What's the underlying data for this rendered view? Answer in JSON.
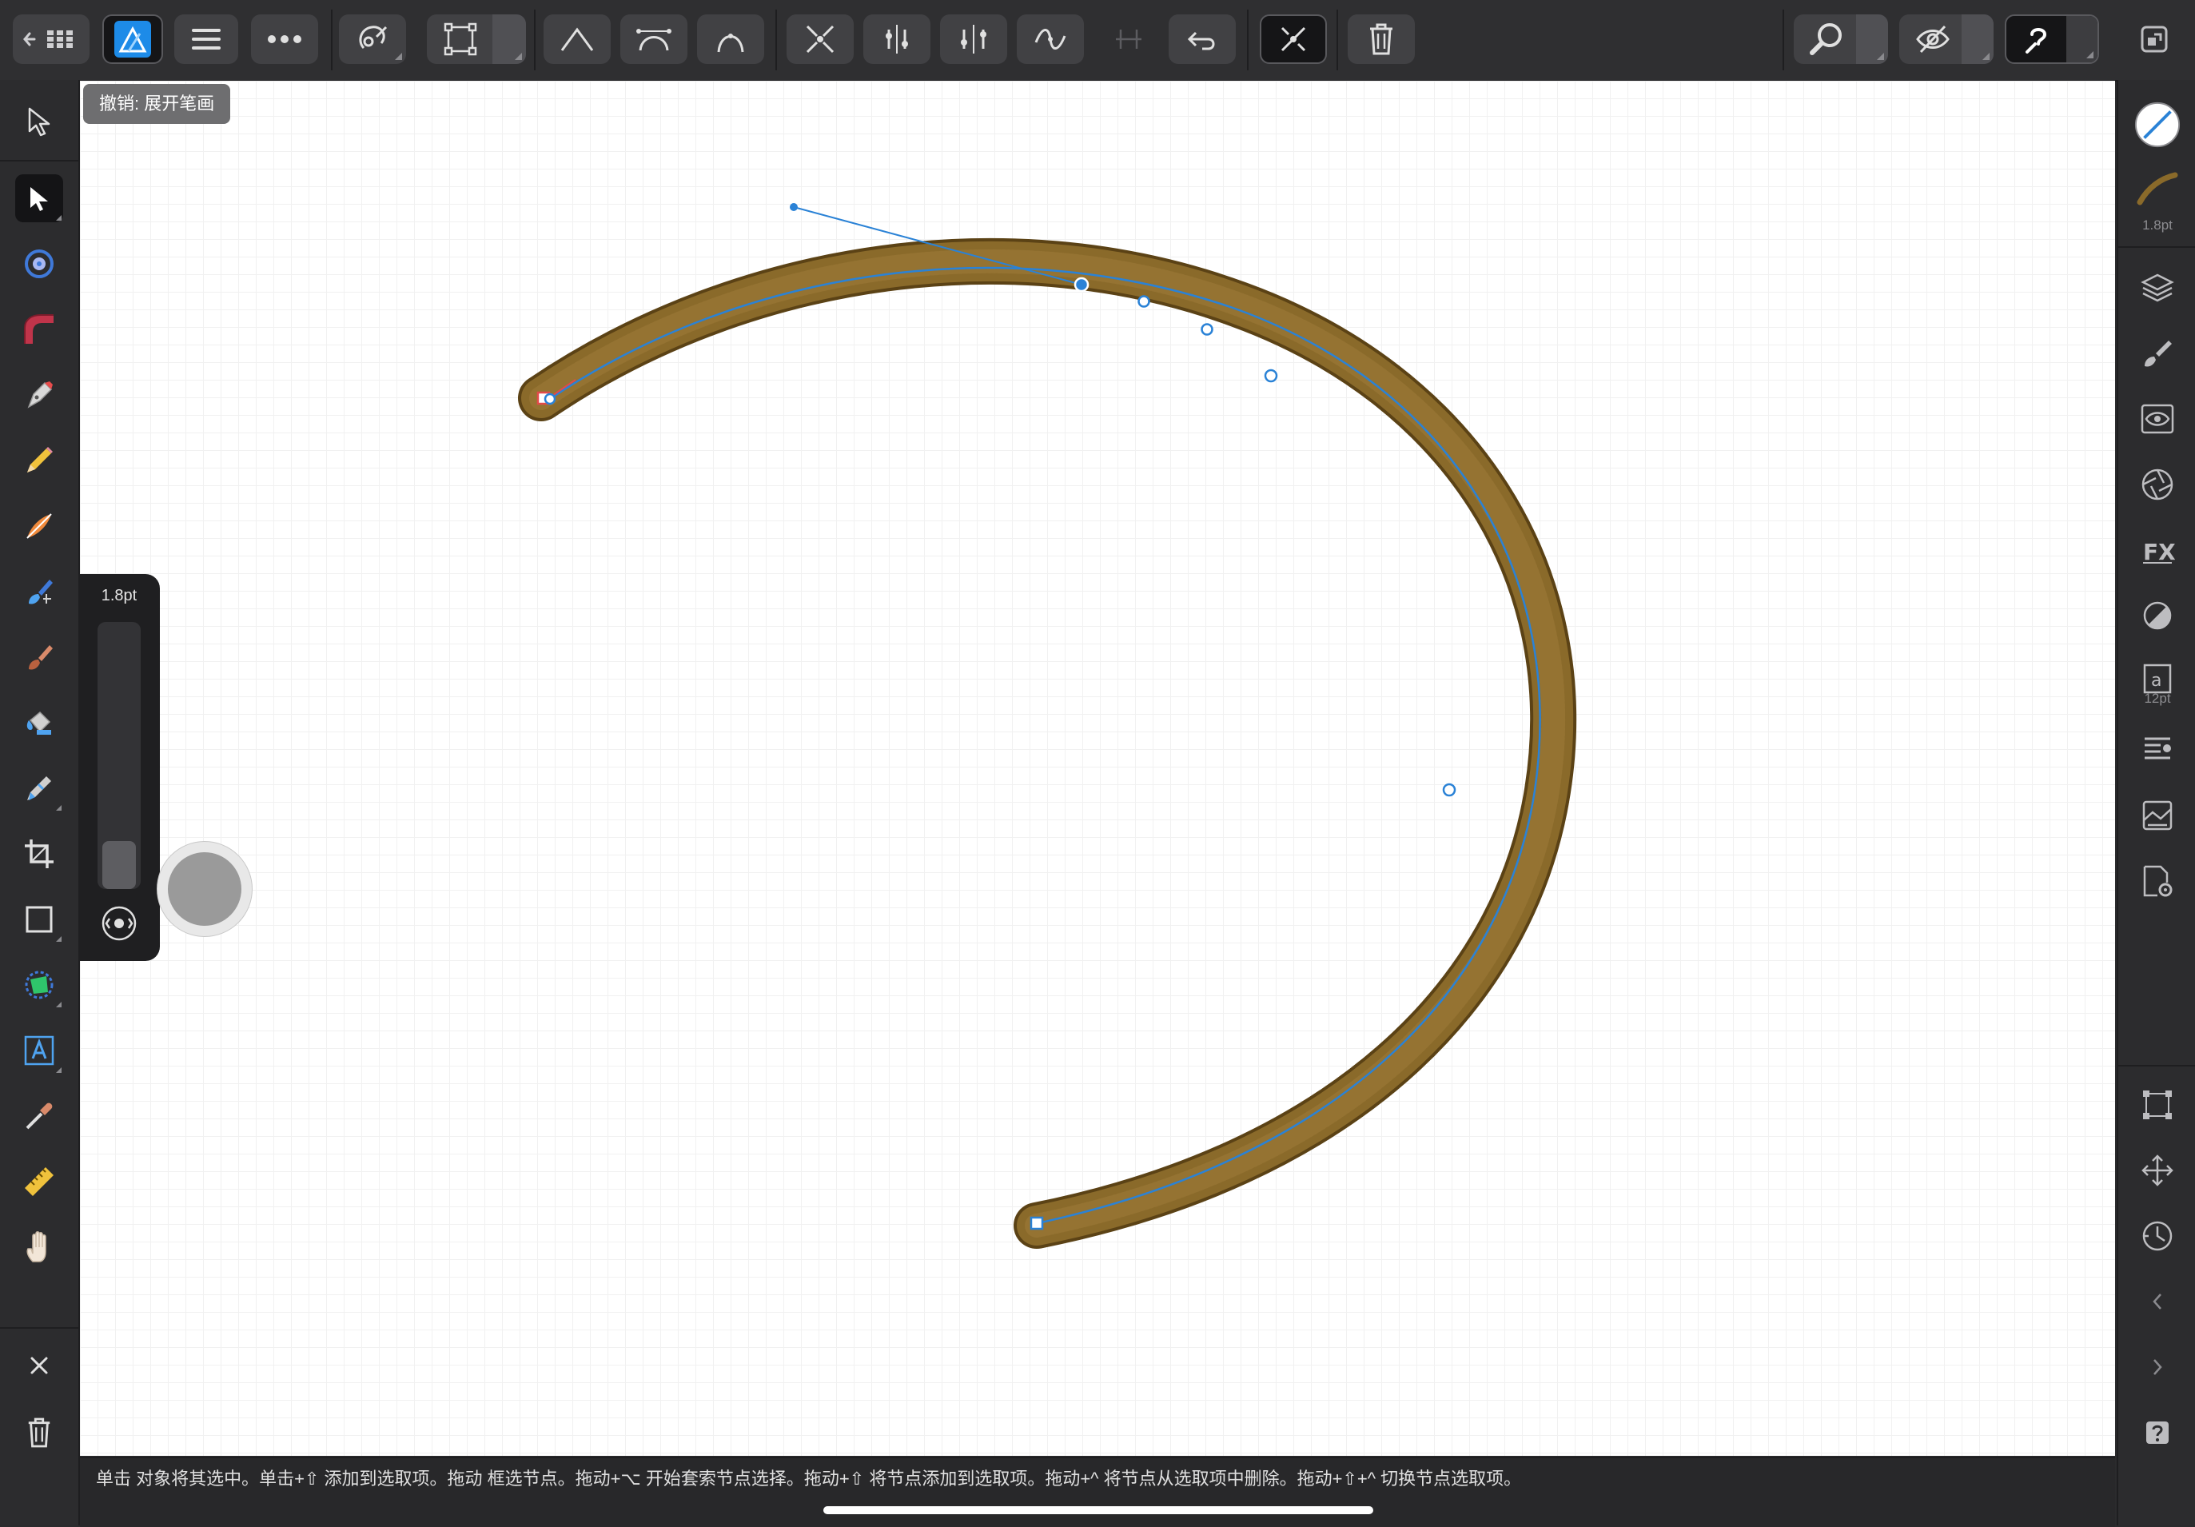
{
  "app": {
    "name": "Affinity Designer",
    "persona": "Designer"
  },
  "colors": {
    "accent": "#2a82d6",
    "stroke_fill": "#8a6a2a",
    "curve_line": "#2a82d6",
    "canvas": "#ffffff",
    "toolbar_bg": "#2f2f31"
  },
  "toolbar": {
    "back_icon": "back-to-documents-icon",
    "items": [
      "affinity-designer-persona-icon",
      "menu-icon",
      "more-icon",
      "snapping-icon",
      "transform-mode-icon",
      "sharp-node-icon",
      "smooth-node-icon",
      "smart-node-icon",
      "break-curve-icon",
      "align-nodes-icon",
      "distribute-nodes-icon",
      "convert-to-smooth-icon",
      "join-curves-icon",
      "reverse-curve-icon",
      "show-stroke-handles-icon",
      "delete-node-icon",
      "zoom-icon",
      "view-mode-icon",
      "help-icon",
      "fullscreen-icon"
    ]
  },
  "left_tools": [
    "move-tool",
    "node-tool",
    "corner-tool",
    "gradient-tool",
    "pen-tool",
    "pencil-tool",
    "vector-brush-tool",
    "pixel-brush-tool",
    "paint-brush-tool",
    "fill-tool",
    "transparency-tool",
    "crop-tool",
    "rectangle-tool",
    "shape-tool",
    "text-tool",
    "color-picker-tool",
    "measure-tool",
    "hand-tool"
  ],
  "right_studio": {
    "stroke_width": "1.8pt",
    "text_size": "12pt",
    "panels": [
      "color-panel",
      "stroke-panel",
      "layers-panel",
      "brushes-panel",
      "effects-panel",
      "appearance-panel",
      "fx-panel",
      "gradient-panel",
      "character-panel",
      "paragraph-panel",
      "styles-panel",
      "document-panel",
      "transform-panel",
      "move-panel",
      "history-panel",
      "collapse-left",
      "expand-right",
      "help-panel"
    ]
  },
  "canvas": {
    "undo_tip": "撤销: 展开笔画",
    "curve_description": "brown brushed stroke arc with selected nodes"
  },
  "brush_slider": {
    "label": "1.8pt",
    "level": 0.18
  },
  "status": {
    "text": "单击 对象将其选中。单击+⇧ 添加到选取项。拖动 框选节点。拖动+⌥ 开始套索节点选择。拖动+⇧ 将节点添加到选取项。拖动+^ 将节点从选取项中删除。拖动+⇧+^ 切换节点选取项。"
  },
  "context_actions": {
    "close": "close-icon",
    "delete": "trash-icon"
  }
}
